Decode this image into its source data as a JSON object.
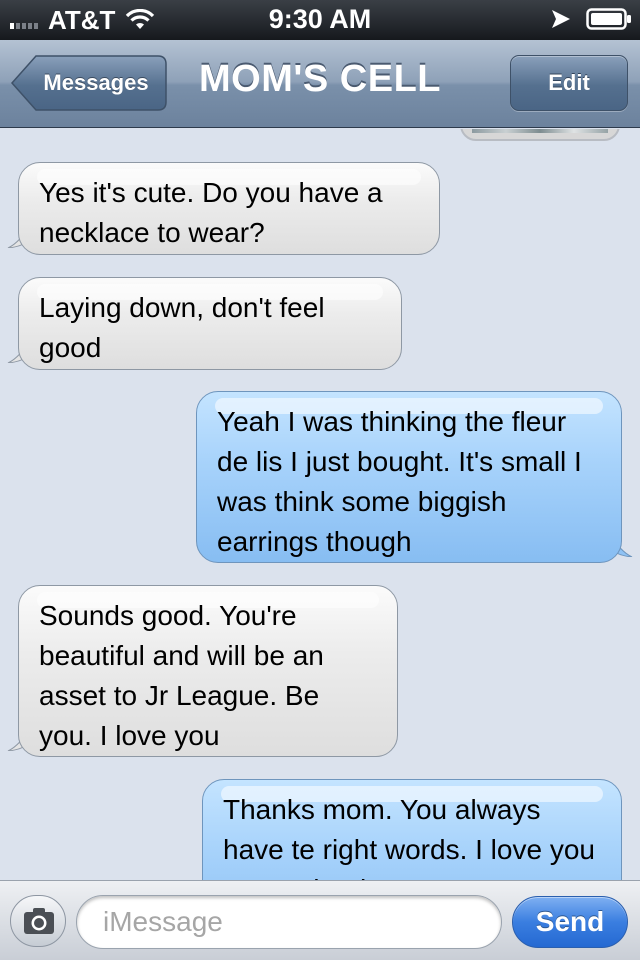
{
  "status_bar": {
    "carrier": "AT&T",
    "time": "9:30 AM",
    "signal_bars": 1,
    "icons": [
      "signal-icon",
      "wifi-icon",
      "location-arrow-icon",
      "battery-icon"
    ]
  },
  "nav": {
    "back_label": "Messages",
    "title": "MOM'S CELL",
    "edit_label": "Edit"
  },
  "messages": [
    {
      "direction": "incoming",
      "text": "Yes it's cute. Do you have a necklace to wear?"
    },
    {
      "direction": "incoming",
      "text": "Laying down, don't feel good"
    },
    {
      "direction": "outgoing",
      "text": "Yeah I was thinking the fleur de lis I just bought. It's small I was think some biggish earrings though"
    },
    {
      "direction": "incoming",
      "text": "Sounds good. You're beautiful and will be an asset to Jr League. Be you. I love you"
    },
    {
      "direction": "outgoing",
      "text": "Thanks mom. You always have te right words. I love you so much. I hope you"
    }
  ],
  "composer": {
    "placeholder": "iMessage",
    "send_label": "Send",
    "camera_icon": "camera-icon"
  },
  "colors": {
    "incoming_bubble": "#e6e6e6",
    "outgoing_bubble": "#a8d3fb",
    "nav_bar": "#8ea1b8",
    "send_button": "#3a7ee0",
    "background": "#dbe2ed"
  }
}
